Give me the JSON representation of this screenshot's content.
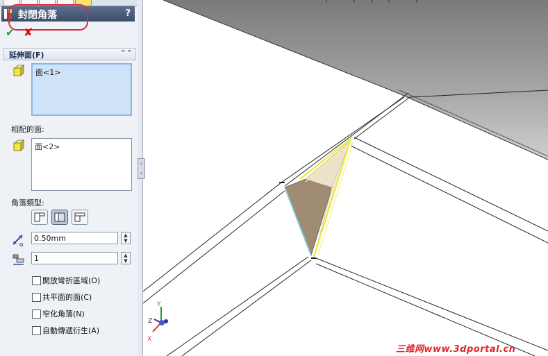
{
  "panel": {
    "title": "封閉角落",
    "help": "?",
    "ok": "✔",
    "cancel": "✘",
    "section_title": "延伸面(F)",
    "faces_to_extend": {
      "items": [
        "面<1>"
      ]
    },
    "matching_faces_label": "相配的面:",
    "matching_faces": {
      "items": [
        "面<2>"
      ]
    },
    "corner_type_label": "角落類型:",
    "corner_types": [
      {
        "name": "butt",
        "selected": false
      },
      {
        "name": "overlap",
        "selected": true
      },
      {
        "name": "underlap",
        "selected": false
      }
    ],
    "gap_value": "0.50mm",
    "overlap_ratio": "1",
    "options": [
      {
        "label": "開放彎折區域(O)",
        "checked": false
      },
      {
        "label": "共平面的面(C)",
        "checked": false
      },
      {
        "label": "窄化角落(N)",
        "checked": false
      },
      {
        "label": "自動傳遞衍生(A)",
        "checked": false
      }
    ]
  },
  "viewport": {
    "triad": {
      "x": "X",
      "y": "Y",
      "z": "Z"
    }
  },
  "watermark": "三维网www.3dportal.cn",
  "colors": {
    "panel_bg": "#eef1f6",
    "title_bar": "#3d4d68",
    "active_list": "#cfe3f8",
    "annotation_ring": "#e02a40",
    "highlight_edge": "#e8ec50",
    "highlight_edge2": "#7cc8d8",
    "watermark": "#e4252d"
  }
}
